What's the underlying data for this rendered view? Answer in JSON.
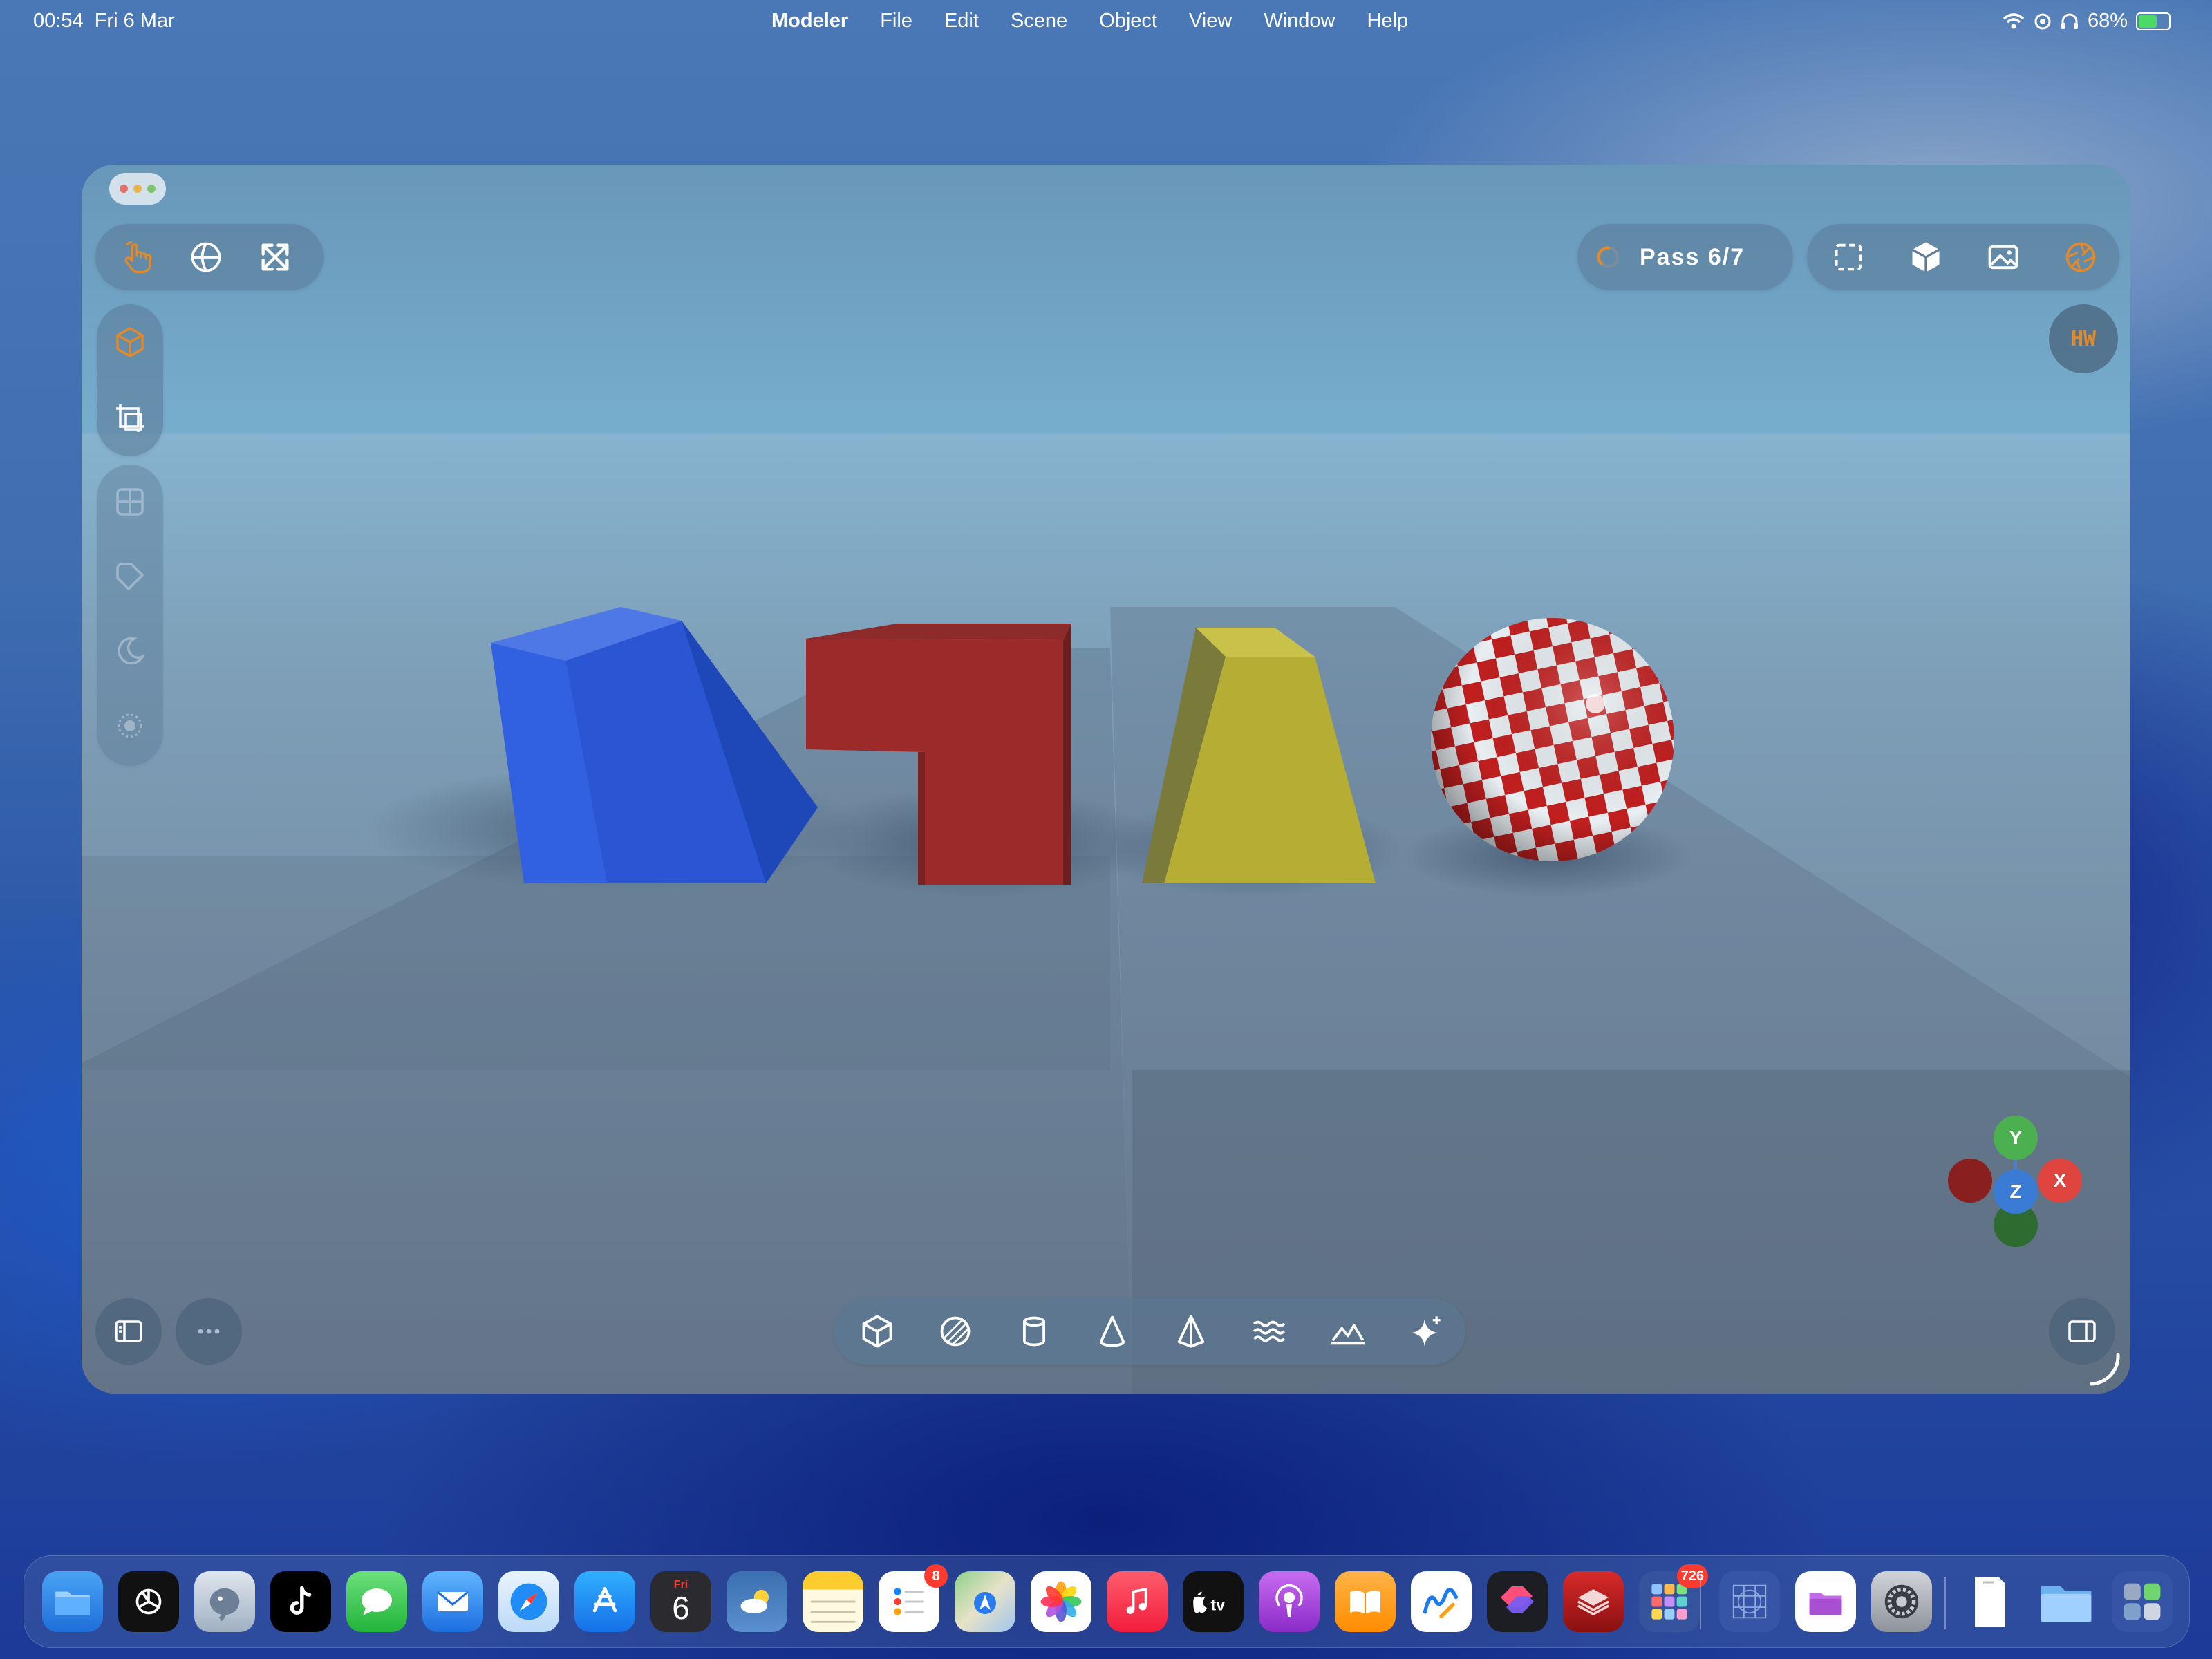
{
  "menubar": {
    "time": "00:54",
    "date": "Fri 6 Mar",
    "app_name": "Modeler",
    "menus": [
      "File",
      "Edit",
      "Scene",
      "Object",
      "View",
      "Window",
      "Help"
    ],
    "battery_percent": "68%",
    "battery_level": 0.68
  },
  "toolbar_left": {
    "icons": [
      "hand-pointer-icon",
      "globe-grid-icon",
      "expand-arrows-icon"
    ]
  },
  "render": {
    "pass_label": "Pass 6/7",
    "icons": [
      "spinner-icon",
      "selection-rect-icon",
      "cube-solid-icon",
      "image-icon",
      "aperture-icon"
    ]
  },
  "hw_badge": "HW",
  "side_tools": [
    "object-cube-icon",
    "transform-icon",
    "grid-icon",
    "tag-icon",
    "moon-icon",
    "dot-icon"
  ],
  "primitives": [
    "cube",
    "sphere",
    "cylinder",
    "cone",
    "pyramid",
    "water",
    "terrain",
    "sparkle"
  ],
  "axes": {
    "y": "Y",
    "x": "X",
    "z": "Z"
  },
  "colors": {
    "accent": "#e08a2c",
    "axis_x": "#e0443e",
    "axis_y": "#4caf50",
    "axis_z": "#3a7bd5"
  },
  "dock": {
    "calendar_day": "Fri",
    "calendar_date": "6",
    "reminders_badge": "8",
    "launchpad_badge": "726",
    "apps": [
      "Files",
      "ChatGPT",
      "TablePlus",
      "TikTok",
      "Messages",
      "Mail",
      "Safari",
      "App Store",
      "Calendar",
      "Weather",
      "Notes",
      "Reminders",
      "Maps",
      "Photos",
      "Music",
      "TV",
      "Podcasts",
      "Books",
      "Freeform",
      "Shortcuts",
      "Modeler",
      "Apps",
      "Blueprint",
      "Folder",
      "Settings",
      "Document",
      "Downloads",
      "App Library"
    ]
  }
}
